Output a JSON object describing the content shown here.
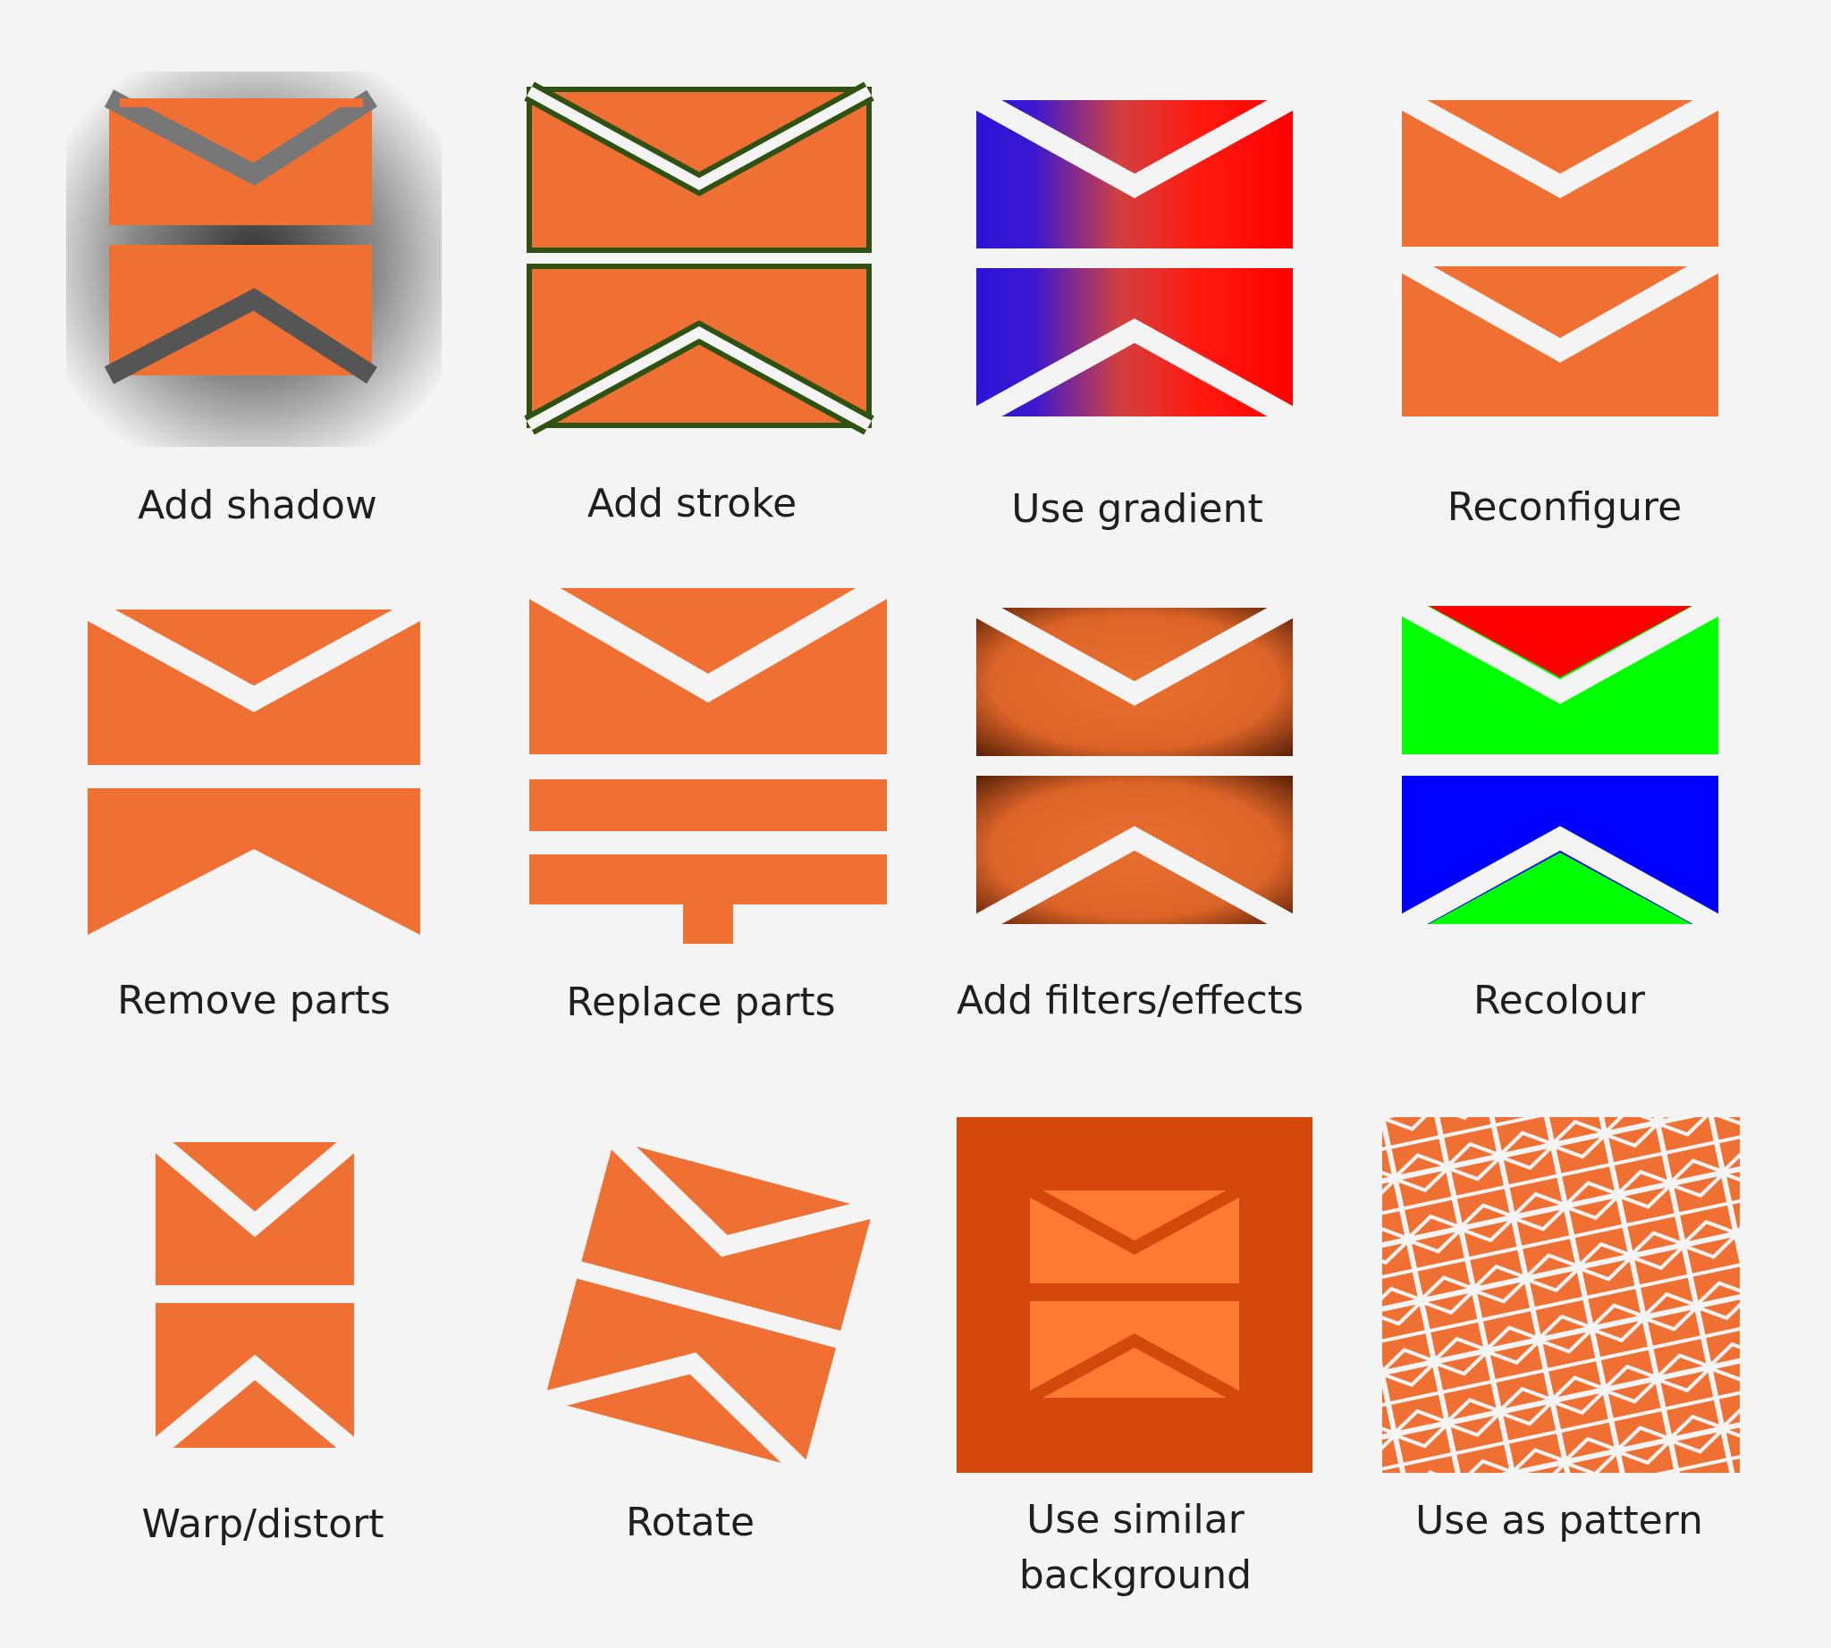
{
  "colors": {
    "background": "#f4f4f4",
    "envelope": "#f07033",
    "envelope_light": "#ff7a33",
    "dark_background": "#d4480b",
    "stroke": "#2e5212",
    "gap": "#f4f4f4",
    "gradient_start": "#2d14d8",
    "gradient_end": "#ff0000",
    "recolour_red": "#ff0000",
    "recolour_green": "#00ff00",
    "recolour_blue": "#0000ff"
  },
  "variants": [
    {
      "label": "Add shadow",
      "icon": "envelope-shadow-icon"
    },
    {
      "label": "Add stroke",
      "icon": "envelope-stroke-icon"
    },
    {
      "label": "Use gradient",
      "icon": "envelope-gradient-icon"
    },
    {
      "label": "Reconfigure",
      "icon": "envelope-reconfigure-icon"
    },
    {
      "label": "Remove parts",
      "icon": "envelope-remove-parts-icon"
    },
    {
      "label": "Replace parts",
      "icon": "envelope-replace-parts-icon"
    },
    {
      "label": "Add filters/effects",
      "icon": "envelope-filter-icon"
    },
    {
      "label": "Recolour",
      "icon": "envelope-recolour-icon"
    },
    {
      "label": "Warp/distort",
      "icon": "envelope-warp-icon"
    },
    {
      "label": "Rotate",
      "icon": "envelope-rotate-icon"
    },
    {
      "label": "Use similar background",
      "icon": "envelope-background-icon"
    },
    {
      "label": "Use as pattern",
      "icon": "envelope-pattern-icon"
    }
  ]
}
